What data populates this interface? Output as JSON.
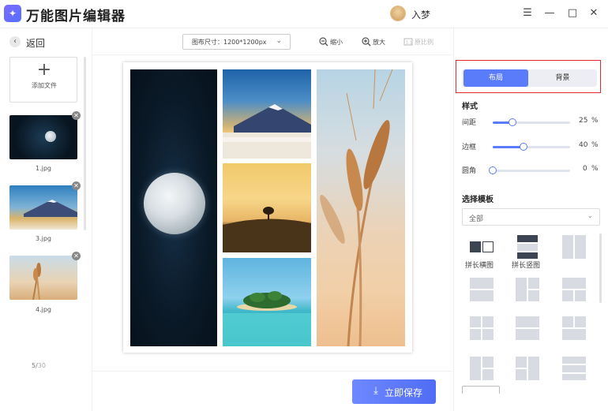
{
  "app": {
    "title": "万能图片编辑器",
    "logo_glyph": "✦",
    "user_name": "入梦"
  },
  "window_controls": {
    "menu": "☰",
    "minimize": "—",
    "maximize": "□",
    "close": "✕"
  },
  "left_panel": {
    "back_label": "返回",
    "back_glyph": "‹",
    "add_file": {
      "plus": "+",
      "label": "添加文件"
    },
    "thumbnails": [
      {
        "name": "1.jpg"
      },
      {
        "name": "3.jpg"
      },
      {
        "name": "4.jpg"
      }
    ],
    "remove_glyph": "✕",
    "page_current": "5/",
    "page_total": "30"
  },
  "toolbar": {
    "canvas_size_label": "图布尺寸：1200*1200px",
    "caret": "⌄",
    "zoom_out": "缩小",
    "zoom_in": "放大",
    "original_ratio": "原比例"
  },
  "save_button": {
    "label": "立即保存",
    "icon": "⤓"
  },
  "right_panel": {
    "tabs": [
      {
        "label": "布局",
        "active": true
      },
      {
        "label": "背景",
        "active": false
      }
    ],
    "style_title": "样式",
    "sliders": [
      {
        "label": "间距",
        "value": "25",
        "unit": "%",
        "fraction": 0.25
      },
      {
        "label": "边框",
        "value": "40",
        "unit": "%",
        "fraction": 0.4
      },
      {
        "label": "圆角",
        "value": "0",
        "unit": "%",
        "fraction": 0.0
      }
    ],
    "template_title": "选择模板",
    "template_filter": "全部",
    "template_captions": [
      "拼长横图",
      "拼长竖图"
    ]
  },
  "colors": {
    "accent": "#5b7cfa",
    "highlight_box": "#e8262b"
  }
}
